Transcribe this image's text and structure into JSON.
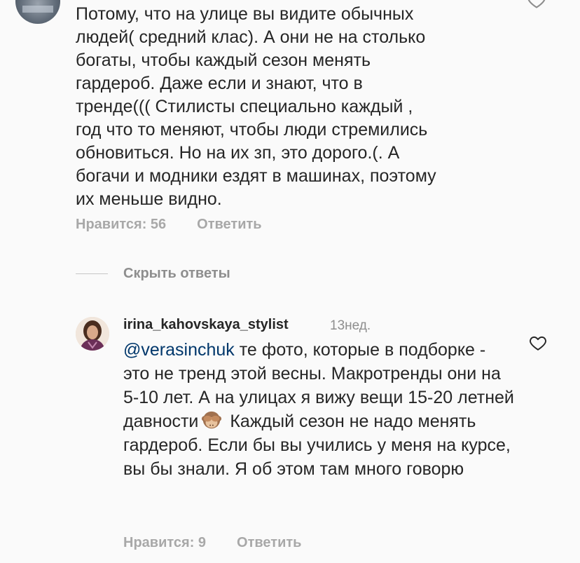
{
  "top_comment": {
    "text": "Потому, что на улице вы видите обычных\nлюдей( средний клас). А они не на столько\nбогаты, чтобы каждый сезон менять\nгардероб. Даже если и знают, что в\nтренде((( Стилисты специально каждый ,\nгод что то меняют, чтобы люди стремились\nобновиться. Но на их зп, это дорого.(. А\nбогачи и модники ездят в машинах, поэтому\nих меньше видно.",
    "likes_label": "Нравится: 56",
    "reply_label": "Ответить"
  },
  "replies_toggle": {
    "label": "Скрыть ответы"
  },
  "reply": {
    "username": "irina_kahovskaya_stylist",
    "time": "13нед.",
    "mention": "@verasinchuk",
    "text_part1": " те фото, которые в подборке - это не тренд этой весны. Макротренды они на 5-10 лет. А на улицах я вижу вещи 15-20 летней давности",
    "emoji": "see-no-evil-monkey",
    "text_part2": " Каждый сезон не надо менять гардероб. Если бы вы учились у меня на курсе, вы бы знали. Я об этом там много говорю",
    "likes_label": "Нравится: 9",
    "reply_label": "Ответить"
  },
  "icons": {
    "like": "heart-outline-icon"
  },
  "colors": {
    "text": "#262626",
    "meta": "#a8a8a8",
    "mention": "#00376b",
    "background": "#fafafa"
  }
}
